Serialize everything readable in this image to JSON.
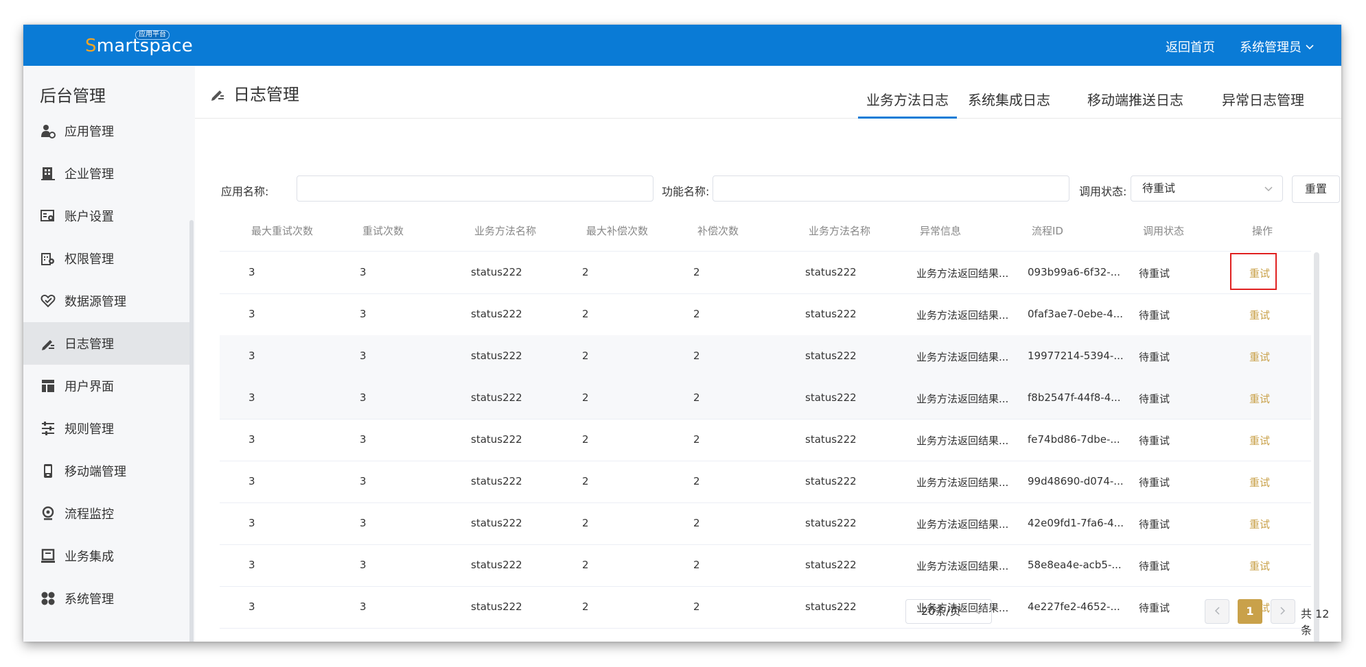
{
  "header": {
    "logo_s": "S",
    "logo_rest": "martspace",
    "logo_badge": "应用平台",
    "home_link": "返回首页",
    "user_menu": "系统管理员"
  },
  "sidebar": {
    "title": "后台管理",
    "items": [
      {
        "label": "应用管理",
        "icon": "app-manage-icon"
      },
      {
        "label": "企业管理",
        "icon": "building-icon"
      },
      {
        "label": "账户设置",
        "icon": "account-settings-icon"
      },
      {
        "label": "权限管理",
        "icon": "permission-icon"
      },
      {
        "label": "数据源管理",
        "icon": "datasource-icon"
      },
      {
        "label": "日志管理",
        "icon": "log-icon",
        "active": true
      },
      {
        "label": "用户界面",
        "icon": "layout-icon"
      },
      {
        "label": "规则管理",
        "icon": "rules-icon"
      },
      {
        "label": "移动端管理",
        "icon": "mobile-icon"
      },
      {
        "label": "流程监控",
        "icon": "monitor-icon"
      },
      {
        "label": "业务集成",
        "icon": "integration-icon"
      },
      {
        "label": "系统管理",
        "icon": "system-icon"
      }
    ]
  },
  "page": {
    "title": "日志管理",
    "tabs": [
      "业务方法日志",
      "系统集成日志",
      "移动端推送日志",
      "异常日志管理"
    ],
    "active_tab": 0
  },
  "filters": {
    "app_name_label": "应用名称:",
    "app_name_value": "",
    "function_name_label": "功能名称:",
    "function_name_value": "",
    "status_label": "调用状态:",
    "status_value": "待重试",
    "reset_label": "重置"
  },
  "table": {
    "columns": [
      "最大重试次数",
      "重试次数",
      "业务方法名称",
      "最大补偿次数",
      "补偿次数",
      "业务方法名称",
      "异常信息",
      "流程ID",
      "调用状态",
      "操作"
    ],
    "rows": [
      [
        "3",
        "3",
        "status222",
        "2",
        "2",
        "status222",
        "业务方法返回结果...",
        "093b99a6-6f32-...",
        "待重试",
        "重试"
      ],
      [
        "3",
        "3",
        "status222",
        "2",
        "2",
        "status222",
        "业务方法返回结果...",
        "0faf3ae7-0ebe-4...",
        "待重试",
        "重试"
      ],
      [
        "3",
        "3",
        "status222",
        "2",
        "2",
        "status222",
        "业务方法返回结果...",
        "19977214-5394-...",
        "待重试",
        "重试"
      ],
      [
        "3",
        "3",
        "status222",
        "2",
        "2",
        "status222",
        "业务方法返回结果...",
        "f8b2547f-44f8-4...",
        "待重试",
        "重试"
      ],
      [
        "3",
        "3",
        "status222",
        "2",
        "2",
        "status222",
        "业务方法返回结果...",
        "fe74bd86-7dbe-...",
        "待重试",
        "重试"
      ],
      [
        "3",
        "3",
        "status222",
        "2",
        "2",
        "status222",
        "业务方法返回结果...",
        "99d48690-d074-...",
        "待重试",
        "重试"
      ],
      [
        "3",
        "3",
        "status222",
        "2",
        "2",
        "status222",
        "业务方法返回结果...",
        "42e09fd1-7fa6-4...",
        "待重试",
        "重试"
      ],
      [
        "3",
        "3",
        "status222",
        "2",
        "2",
        "status222",
        "业务方法返回结果...",
        "58e8ea4e-acb5-...",
        "待重试",
        "重试"
      ],
      [
        "3",
        "3",
        "status222",
        "2",
        "2",
        "status222",
        "业务方法返回结果...",
        "4e227fe2-4652-...",
        "待重试",
        "重试"
      ]
    ]
  },
  "pagination": {
    "page_size": "20条/页",
    "prev": "<",
    "current": "1",
    "next": ">",
    "total": "共 12 条"
  },
  "colors": {
    "header_bg": "#0a7bd6",
    "accent_gold": "#c9a14a",
    "highlight_red": "#e02020"
  }
}
